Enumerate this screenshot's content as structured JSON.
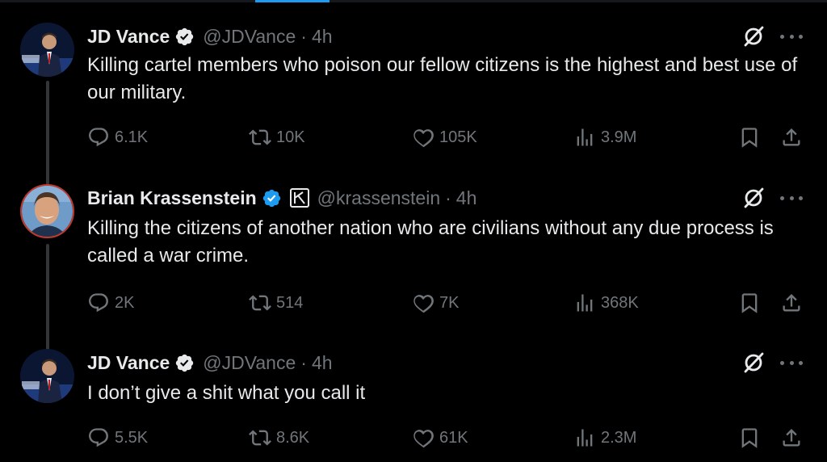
{
  "tweets": [
    {
      "name": "JD Vance",
      "handle": "@JDVance",
      "separator": "·",
      "time": "4h",
      "verified": true,
      "affiliation_badge": false,
      "avatar": "jd-vance-avatar",
      "text": "Killing cartel members who poison our fellow citizens is the highest and best use of our military.",
      "stats": {
        "replies": "6.1K",
        "retweets": "10K",
        "likes": "105K",
        "views": "3.9M"
      }
    },
    {
      "name": "Brian Krassenstein",
      "handle": "@krassenstein",
      "separator": "·",
      "time": "4h",
      "verified": true,
      "affiliation_badge": true,
      "avatar": "brian-krassenstein-avatar",
      "text": "Killing the citizens of another nation who are civilians without any due process is called a war crime.",
      "stats": {
        "replies": "2K",
        "retweets": "514",
        "likes": "7K",
        "views": "368K"
      }
    },
    {
      "name": "JD Vance",
      "handle": "@JDVance",
      "separator": "·",
      "time": "4h",
      "verified": true,
      "affiliation_badge": false,
      "avatar": "jd-vance-avatar",
      "text": "I don’t give a shit what you call it",
      "stats": {
        "replies": "5.5K",
        "retweets": "8.6K",
        "likes": "61K",
        "views": "2.3M"
      }
    }
  ],
  "colors": {
    "background": "#000000",
    "text_primary": "#e7e9ea",
    "text_secondary": "#71767b",
    "verified": "#1d9bf0",
    "thread_line": "#333639"
  }
}
